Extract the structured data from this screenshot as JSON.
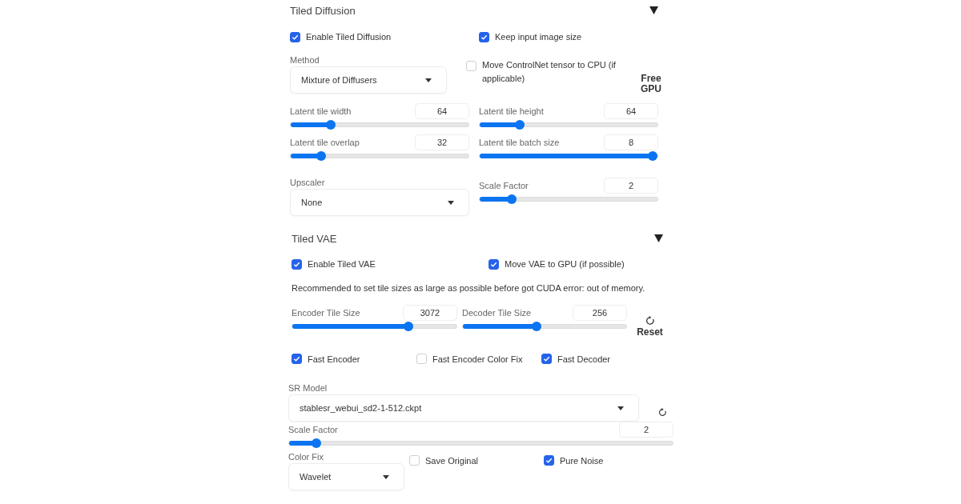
{
  "tiled_diffusion": {
    "title": "Tiled Diffusion",
    "expanded": true,
    "options": [
      {
        "label": "Enable Tiled Diffusion",
        "checked": true
      },
      {
        "label": "Keep input image size",
        "checked": true
      }
    ],
    "method": {
      "label": "Method",
      "value": "Mixture of Diffusers"
    },
    "controlnet_to_cpu": {
      "label": "Move ControlNet tensor to CPU (if applicable)",
      "checked": false
    },
    "free_gpu_button": "Free GPU",
    "tile_sliders": [
      {
        "label": "Latent tile width",
        "value": "64",
        "level": 0.21
      },
      {
        "label": "Latent tile height",
        "value": "64",
        "level": 0.21
      },
      {
        "label": "Latent tile overlap",
        "value": "32",
        "level": 0.15
      },
      {
        "label": "Latent tile batch size",
        "value": "8",
        "level": 1
      }
    ],
    "upscaler": {
      "label": "Upscaler",
      "value": "None"
    },
    "scale_factor": {
      "label": "Scale Factor",
      "value": "2",
      "level": 0.16
    }
  },
  "tiled_vae": {
    "title": "Tiled VAE",
    "expanded": true,
    "options": [
      {
        "label": "Enable Tiled VAE",
        "checked": true
      },
      {
        "label": "Move VAE to GPU (if possible)",
        "checked": true
      }
    ],
    "note": "Recommended to set tile sizes as large as possible before got CUDA error: out of memory.",
    "tile_sliders": [
      {
        "label": "Encoder Tile Size",
        "value": "3072",
        "level": 0.72
      },
      {
        "label": "Decoder Tile Size",
        "value": "256",
        "level": 0.45
      }
    ],
    "reset_button": "Reset",
    "fast_options": [
      {
        "label": "Fast Encoder",
        "checked": true
      },
      {
        "label": "Fast Encoder Color Fix",
        "checked": false
      },
      {
        "label": "Fast Decoder",
        "checked": true
      }
    ]
  },
  "stablesr": {
    "sr_model": {
      "label": "SR Model",
      "value": "stablesr_webui_sd2-1-512.ckpt"
    },
    "scale_factor": {
      "label": "Scale Factor",
      "value": "2",
      "level": 0.06
    },
    "color_fix": {
      "label": "Color Fix",
      "value": "Wavelet"
    },
    "options": [
      {
        "label": "Save Original",
        "checked": false
      },
      {
        "label": "Pure Noise",
        "checked": true
      }
    ]
  }
}
